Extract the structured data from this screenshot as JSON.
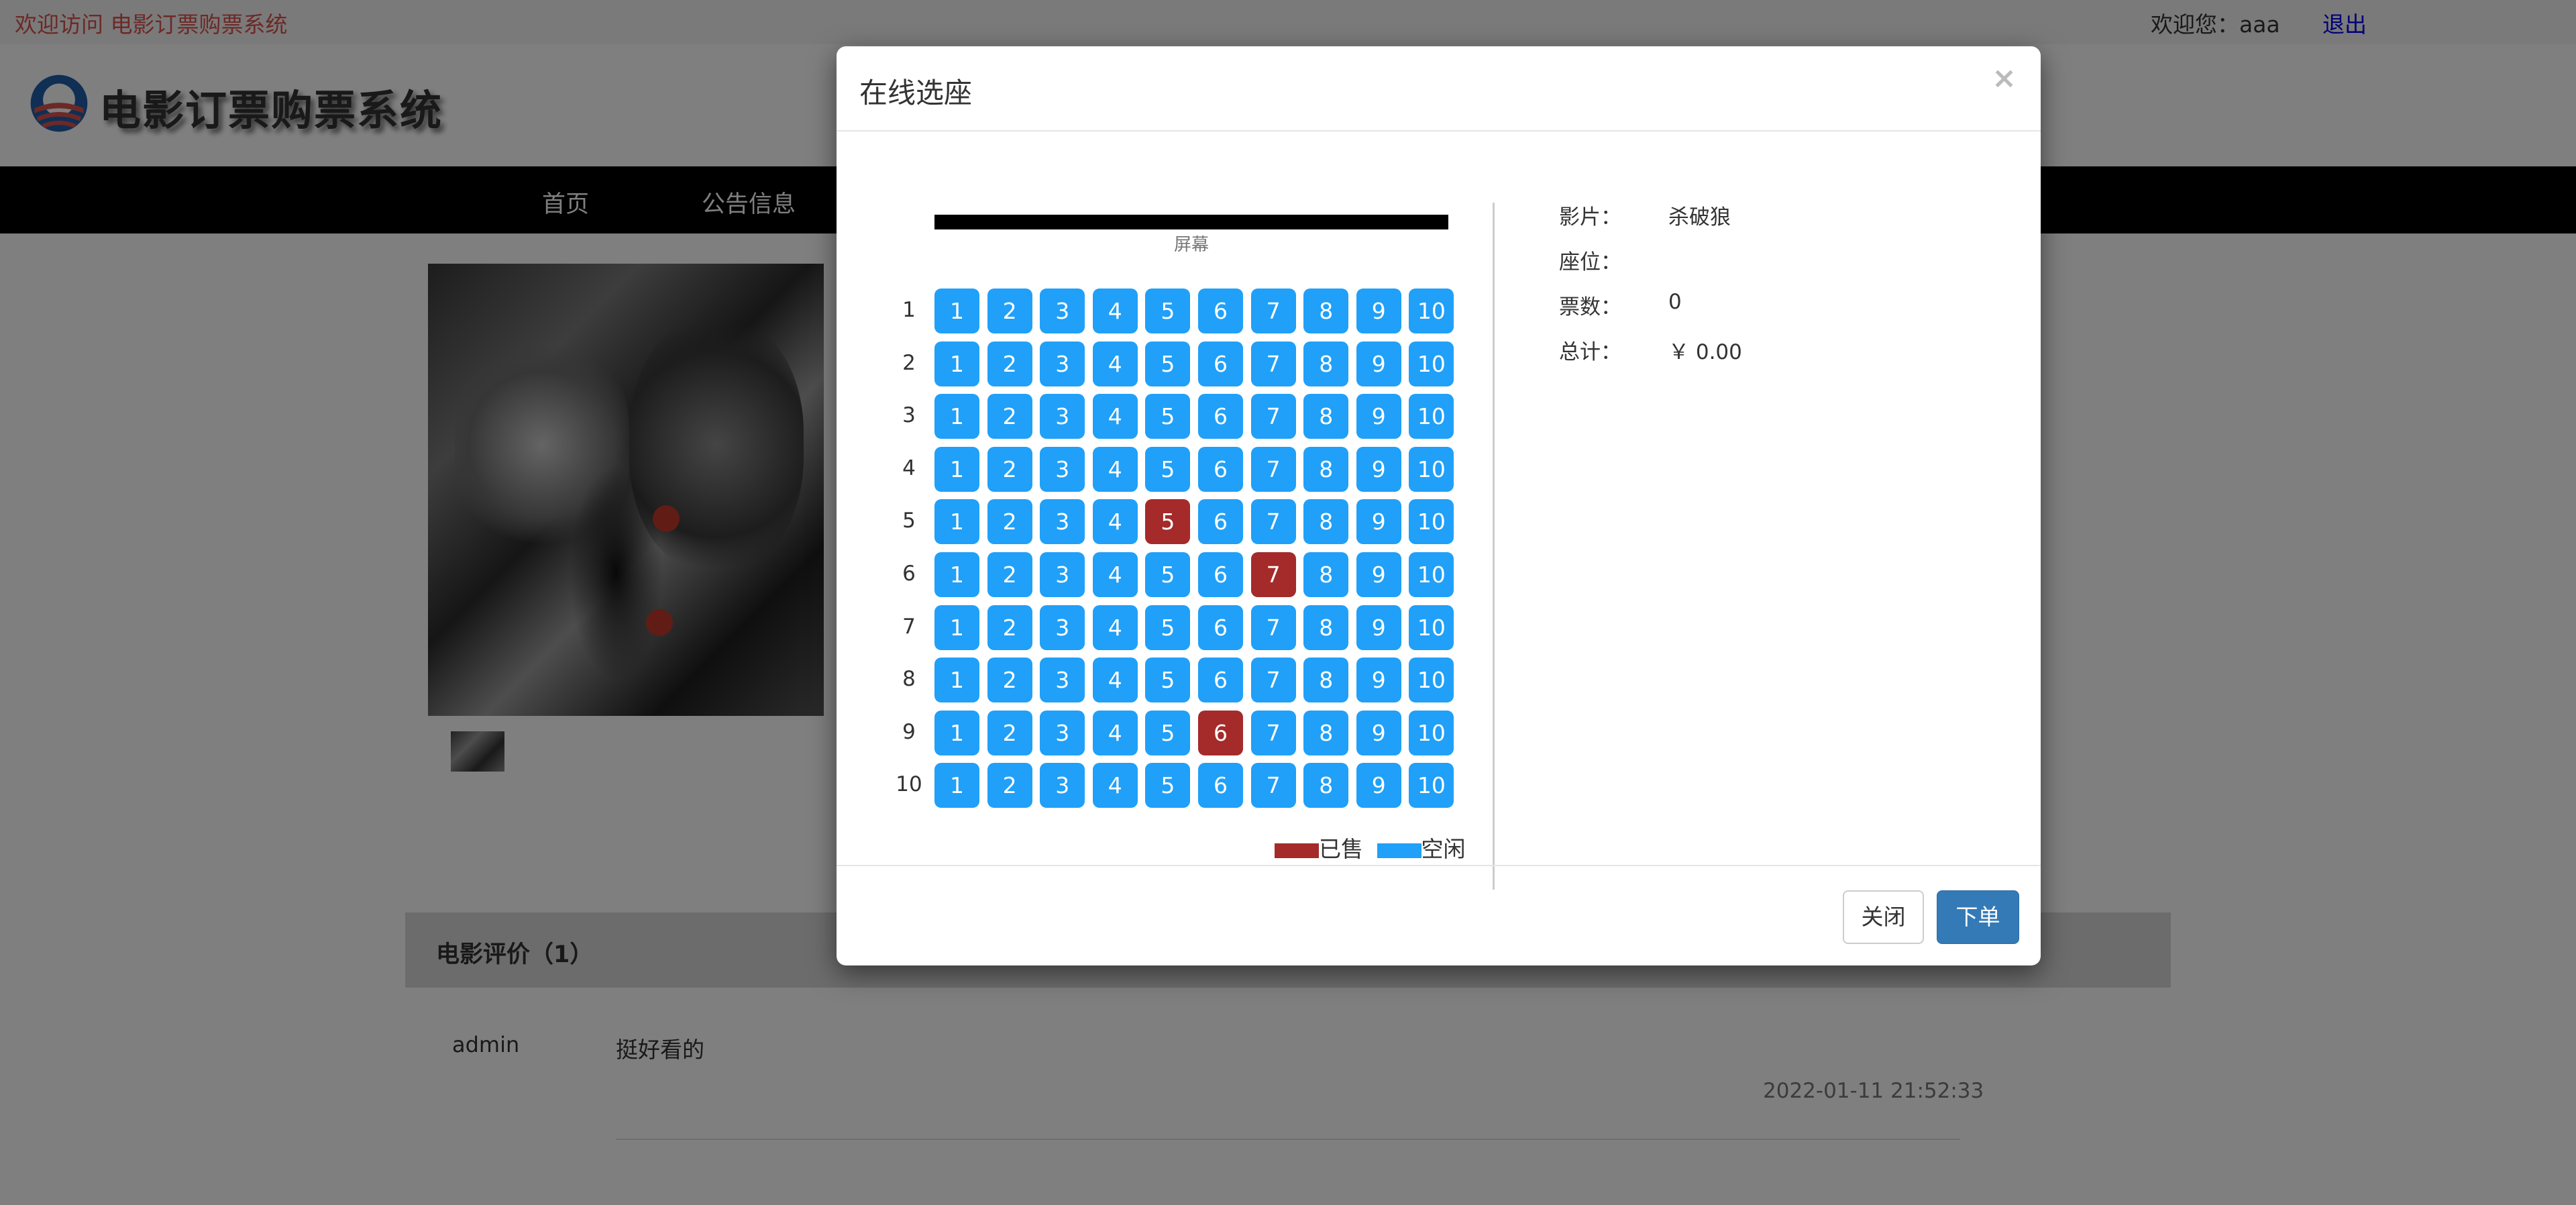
{
  "topbar": {
    "welcome": "欢迎访问 电影订票购票系统",
    "user_greeting": "欢迎您：aaa",
    "logout": "退出"
  },
  "header": {
    "logo_text": "电影订票购票系统"
  },
  "nav": {
    "items": [
      "首页",
      "公告信息"
    ]
  },
  "review": {
    "title": "电影评价（1）",
    "user": "admin",
    "content": "挺好看的",
    "time": "2022-01-11 21:52:33"
  },
  "modal": {
    "title": "在线选座",
    "close_symbol": "×",
    "screen_label": "屏幕",
    "rows": [
      "1",
      "2",
      "3",
      "4",
      "5",
      "6",
      "7",
      "8",
      "9",
      "10"
    ],
    "seat_numbers": [
      "1",
      "2",
      "3",
      "4",
      "5",
      "6",
      "7",
      "8",
      "9",
      "10"
    ],
    "sold_seats": [
      [
        5,
        5
      ],
      [
        6,
        7
      ],
      [
        9,
        6
      ]
    ],
    "legend": {
      "sold": "已售",
      "free": "空闲"
    },
    "colors": {
      "free": "#20a0f8",
      "sold": "#a52a2a",
      "primary": "#337ab7"
    },
    "info": {
      "movie_label": "影片：",
      "movie": "杀破狼",
      "seat_label": "座位：",
      "seat": "",
      "count_label": "票数：",
      "count": "0",
      "total_label": "总计：",
      "total": "￥ 0.00"
    },
    "buttons": {
      "close": "关闭",
      "order": "下单"
    }
  }
}
